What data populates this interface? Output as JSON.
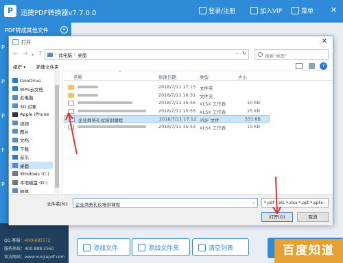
{
  "app": {
    "logo": "P",
    "title": "迅捷PDF转换器v7.7.0.0",
    "login": "登录/注册",
    "vip": "加入VIP",
    "menu": "菜单",
    "tab": "PDF转成其他文件",
    "left_letters": [
      "P",
      "P",
      "P",
      "F",
      "P"
    ],
    "info_line1_label": "QQ 客服：",
    "info_line1_value": "4006685572",
    "info_line2_label": "服务热线：",
    "info_line2_value": "400-888-2560",
    "info_line3": "官方网站：www.xunjiepdf.com",
    "buttons": {
      "add_file": "添加文件",
      "add_folder": "添加文件夹",
      "clear_list": "清空列表"
    },
    "watermark": "百度知道"
  },
  "dialog": {
    "title": "打开",
    "breadcrumb": [
      "此电脑",
      "桌面"
    ],
    "search_placeholder": "搜索\"桌面\"",
    "organize": "组织 ▾",
    "new_folder": "新建文件夹",
    "nav_items": [
      {
        "label": "OneDrive",
        "color": "#2e7ad1"
      },
      {
        "label": "WPS云文档",
        "color": "#2e7ad1"
      },
      {
        "label": "此电脑",
        "color": "#5a8cc2"
      },
      {
        "label": "3D 对象",
        "color": "#5a8cc2"
      },
      {
        "label": "Apple iPhone",
        "color": "#333333"
      },
      {
        "label": "视频",
        "color": "#5a8cc2"
      },
      {
        "label": "图片",
        "color": "#5a8cc2"
      },
      {
        "label": "文档",
        "color": "#5a8cc2"
      },
      {
        "label": "下载",
        "color": "#2e7ad1"
      },
      {
        "label": "音乐",
        "color": "#2e7ad1"
      },
      {
        "label": "桌面",
        "color": "#5a8cc2",
        "selected": true
      },
      {
        "label": "Windows (C:)",
        "color": "#777777"
      },
      {
        "label": "本地磁盘 (D:)",
        "color": "#777777"
      },
      {
        "label": "网络",
        "color": "#5a8cc2"
      }
    ],
    "columns": {
      "name": "名称",
      "date": "修改日期",
      "type": "类型",
      "size": "大小"
    },
    "files": [
      {
        "name": "工作",
        "date": "2018/7/11 17:13",
        "type": "文件夹",
        "size": "",
        "kind": "folder",
        "blur": true
      },
      {
        "name": "资料",
        "date": "2018/7/11 16:31",
        "type": "文件夹",
        "size": "",
        "kind": "folder",
        "blur": true
      },
      {
        "name": "",
        "date": "2018/7/11 15:55",
        "type": "XLSX 工作表",
        "size": "10 KB",
        "kind": "file",
        "blur": true
      },
      {
        "name": "",
        "date": "2018/7/11 15:55",
        "type": "XLSX 工作表",
        "size": "15 KB",
        "kind": "file",
        "blur": true
      },
      {
        "name": "企业商务礼仪培训课程",
        "date": "2018/7/11 17:12",
        "type": "PDF 文件",
        "size": "331 KB",
        "kind": "file",
        "selected": true
      },
      {
        "name": "",
        "date": "2018/7/11 15:53",
        "type": "XLSX 工作表",
        "size": "15 KB",
        "kind": "file",
        "blur": true
      }
    ],
    "filename_label": "文件名(N):",
    "filename_value": "企业商务礼仪培训课程",
    "filter": "*.pdf *.xls *.xlsx *.ppt *.pptx",
    "open": "打开(O)",
    "cancel": "取消"
  }
}
